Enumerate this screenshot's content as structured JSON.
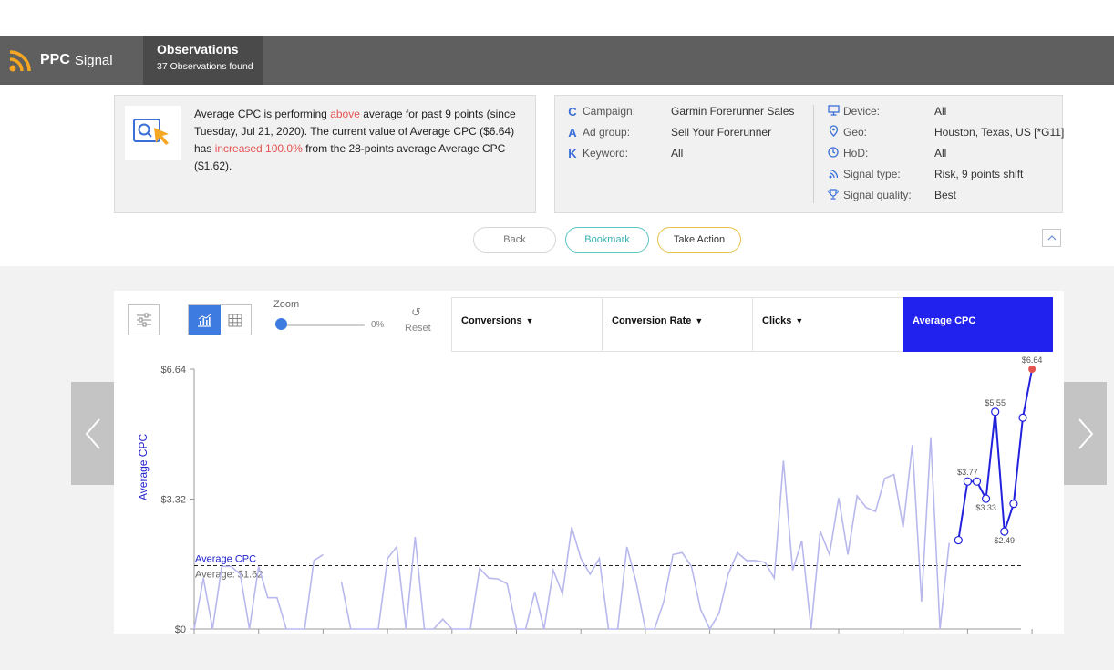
{
  "header": {
    "brand_bold": "PPC",
    "brand_rest": "Signal",
    "tab_title": "Observations",
    "tab_subtitle": "37 Observations found"
  },
  "observation": {
    "metric": "Average CPC",
    "t1": " is performing ",
    "direction": "above",
    "t2": " average for past 9 points (since Tuesday, Jul 21, 2020). The current value of Average CPC ($6.64) has ",
    "change": "increased 100.0%",
    "t3": " from the 28-points average Average CPC ($1.62)."
  },
  "meta": {
    "campaign_label": "Campaign:",
    "campaign_value": "Garmin Forerunner Sales",
    "adgroup_label": "Ad group:",
    "adgroup_value": "Sell Your Forerunner",
    "keyword_label": "Keyword:",
    "keyword_value": "All",
    "device_label": "Device:",
    "device_value": "All",
    "geo_label": "Geo:",
    "geo_value": "Houston, Texas, US [*G11]",
    "hod_label": "HoD:",
    "hod_value": "All",
    "signal_type_label": "Signal type:",
    "signal_type_value": "Risk, 9 points shift",
    "signal_quality_label": "Signal quality:",
    "signal_quality_value": "Best"
  },
  "actions": {
    "back": "Back",
    "bookmark": "Bookmark",
    "take_action": "Take Action"
  },
  "toolbar": {
    "zoom_label": "Zoom",
    "zoom_value": 0,
    "zoom_text": "0%",
    "reset_label": "Reset"
  },
  "metric_tabs": [
    {
      "label": "Conversions",
      "active": false
    },
    {
      "label": "Conversion Rate",
      "active": false
    },
    {
      "label": "Clicks",
      "active": false
    },
    {
      "label": "Average CPC",
      "active": true
    }
  ],
  "colors": {
    "accent": "#3d7be0",
    "active_tab": "#2222ee",
    "highlight": "#2222dd",
    "history": "#b8b8ee",
    "alert": "#e55353",
    "header": "#5f5f5f"
  },
  "chart_data": {
    "type": "line",
    "ylabel": "Average CPC",
    "y_ticks": [
      "$6.64",
      "$3.32",
      "$0"
    ],
    "ylim": [
      0,
      6.64
    ],
    "avg_line_label": "Average CPC",
    "avg_label": "Average: $1.62",
    "average": 1.62,
    "history": [
      0,
      1.3,
      0,
      1.6,
      1.6,
      1.4,
      0,
      1.6,
      0.8,
      0.8,
      0,
      0,
      0,
      1.75,
      1.9,
      null,
      1.2,
      0,
      0,
      0,
      0,
      1.8,
      2.1,
      0,
      2.35,
      0,
      0,
      0.25,
      0,
      0,
      0,
      1.55,
      1.3,
      1.28,
      1.15,
      0,
      0,
      0.95,
      0,
      1.5,
      0.9,
      2.6,
      1.8,
      1.4,
      1.8,
      0,
      0,
      2.1,
      1.2,
      0,
      0,
      0.7,
      1.9,
      1.95,
      1.6,
      0.5,
      0,
      0.4,
      1.4,
      1.95,
      1.75,
      1.75,
      1.7,
      1.3,
      4.3,
      1.5,
      2.25,
      0,
      2.5,
      1.9,
      3.35,
      1.9,
      3.4,
      3.1,
      3.0,
      3.85,
      3.95,
      2.6,
      4.7,
      0.7,
      4.9,
      0,
      2.2
    ],
    "signal": [
      2.27,
      3.77,
      3.77,
      3.33,
      5.55,
      2.49,
      3.2,
      5.4,
      6.64
    ],
    "signal_labels": [
      "",
      "$3.77",
      "",
      "$3.33",
      "$5.55",
      "$2.49",
      "",
      "",
      "$6.64"
    ]
  }
}
